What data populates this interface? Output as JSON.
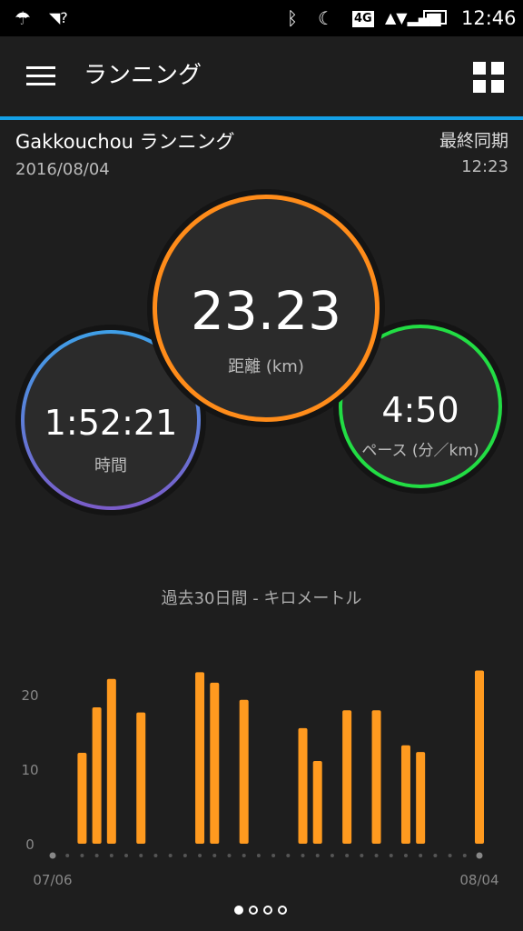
{
  "status_bar": {
    "time": "12:46",
    "network": "4G",
    "icons": [
      "umbrella-icon",
      "wifi-question-icon",
      "bluetooth-icon",
      "moon-icon",
      "signal-icon",
      "battery-icon"
    ]
  },
  "appbar": {
    "title": "ランニング",
    "menu_icon": "menu-icon",
    "grid_icon": "grid-icon",
    "accent_color": "#14a0e6"
  },
  "activity": {
    "name": "Gakkouchou ランニング",
    "date": "2016/08/04",
    "sync_label": "最終同期",
    "sync_time": "12:23"
  },
  "stats": {
    "distance": {
      "value": "23.23",
      "label": "距離 (km)",
      "color": "#ff8c1a"
    },
    "time": {
      "value": "1:52:21",
      "label": "時間",
      "colors": [
        "#3fa0e8",
        "#7b5cc9"
      ]
    },
    "pace": {
      "value": "4:50",
      "label": "ペース (分／km)",
      "color": "#22dd44"
    }
  },
  "chart_data": {
    "type": "bar",
    "title": "過去30日間 - キロメートル",
    "x_start_label": "07/06",
    "x_end_label": "08/04",
    "y_ticks": [
      "0",
      "10",
      "20"
    ],
    "ylim": [
      0,
      25
    ],
    "bar_color": "#ff9a1f",
    "days": 30,
    "values": [
      0,
      0,
      12.2,
      18.3,
      22.1,
      0,
      17.6,
      0,
      0,
      0,
      23.0,
      21.6,
      0,
      19.3,
      0,
      0,
      0,
      15.5,
      11.1,
      0,
      17.9,
      0,
      17.9,
      0,
      13.2,
      12.3,
      0,
      0,
      0,
      23.23
    ]
  },
  "pager": {
    "count": 4,
    "active": 0
  }
}
